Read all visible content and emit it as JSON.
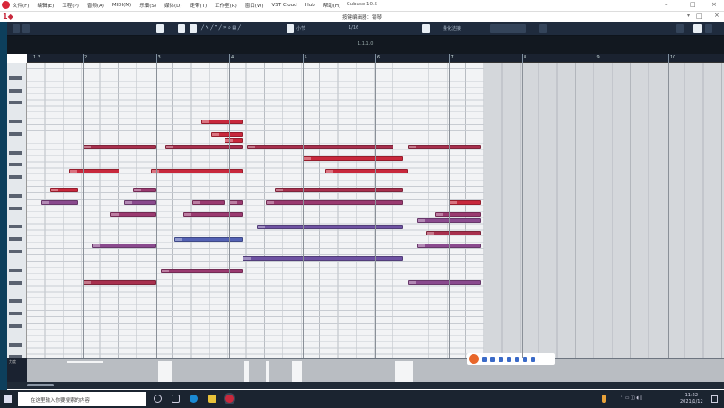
{
  "app": {
    "title": "Cubase 10.5",
    "menu": [
      "文件(F)",
      "编辑(E)",
      "工程(P)",
      "音频(A)",
      "MIDI(M)",
      "乐谱(S)",
      "媒体(D)",
      "走带(T)",
      "工作室(R)",
      "窗口(W)",
      "VST Cloud",
      "Hub",
      "帮助(H)"
    ]
  },
  "editor": {
    "window_title": "按键编辑器：钢琴",
    "position": "1.1.1.0",
    "snap": "小节",
    "quantize": "1/16",
    "length": "量化连接"
  },
  "ruler": {
    "bars": [
      "1.3",
      "2",
      "3",
      "4",
      "5",
      "6",
      "7",
      "8",
      "9",
      "10"
    ]
  },
  "colors": {
    "red": "#c8283c",
    "crimson": "#a8304e",
    "magenta": "#9a3a70",
    "purple": "#8a4a8e",
    "violet": "#6e52a2",
    "blue": "#5462b4"
  },
  "notes": [
    {
      "start": 10.5,
      "length": 2.25,
      "pitch": 75,
      "color": "red"
    },
    {
      "start": 11,
      "length": 1.75,
      "pitch": 73,
      "color": "red"
    },
    {
      "start": 11.75,
      "length": 1,
      "pitch": 72,
      "color": "red"
    },
    {
      "start": 4,
      "length": 4,
      "pitch": 71,
      "color": "crimson"
    },
    {
      "start": 8.5,
      "length": 4.25,
      "pitch": 71,
      "color": "crimson"
    },
    {
      "start": 13,
      "length": 8,
      "pitch": 71,
      "color": "crimson"
    },
    {
      "start": 21.75,
      "length": 4,
      "pitch": 71,
      "color": "crimson"
    },
    {
      "start": 16,
      "length": 5.5,
      "pitch": 69,
      "color": "red"
    },
    {
      "start": 3.25,
      "length": 2.75,
      "pitch": 67,
      "color": "red"
    },
    {
      "start": 7.75,
      "length": 5,
      "pitch": 67,
      "color": "red"
    },
    {
      "start": 17.25,
      "length": 4.5,
      "pitch": 67,
      "color": "red"
    },
    {
      "start": 2.25,
      "length": 1.5,
      "pitch": 64,
      "color": "red"
    },
    {
      "start": 6.75,
      "length": 1.25,
      "pitch": 64,
      "color": "magenta"
    },
    {
      "start": 14.5,
      "length": 7,
      "pitch": 64,
      "color": "crimson"
    },
    {
      "start": 1.75,
      "length": 2,
      "pitch": 62,
      "color": "purple"
    },
    {
      "start": 6.25,
      "length": 1.75,
      "pitch": 62,
      "color": "purple"
    },
    {
      "start": 10,
      "length": 1.75,
      "pitch": 62,
      "color": "magenta"
    },
    {
      "start": 12,
      "length": 0.75,
      "pitch": 62,
      "color": "magenta"
    },
    {
      "start": 14,
      "length": 7.5,
      "pitch": 62,
      "color": "magenta"
    },
    {
      "start": 24,
      "length": 1.75,
      "pitch": 62,
      "color": "red"
    },
    {
      "start": 5.5,
      "length": 2.5,
      "pitch": 60,
      "color": "magenta"
    },
    {
      "start": 9.5,
      "length": 3.25,
      "pitch": 60,
      "color": "magenta"
    },
    {
      "start": 23.25,
      "length": 2.5,
      "pitch": 60,
      "color": "magenta"
    },
    {
      "start": 13.5,
      "length": 8,
      "pitch": 58,
      "color": "violet"
    },
    {
      "start": 22.25,
      "length": 3.5,
      "pitch": 59,
      "color": "purple"
    },
    {
      "start": 22.75,
      "length": 3,
      "pitch": 57,
      "color": "crimson"
    },
    {
      "start": 9,
      "length": 3.75,
      "pitch": 56,
      "color": "blue"
    },
    {
      "start": 4.5,
      "length": 3.5,
      "pitch": 55,
      "color": "purple"
    },
    {
      "start": 22.25,
      "length": 3.5,
      "pitch": 55,
      "color": "purple"
    },
    {
      "start": 12.75,
      "length": 8.75,
      "pitch": 53,
      "color": "violet"
    },
    {
      "start": 8.25,
      "length": 4.5,
      "pitch": 51,
      "color": "magenta"
    },
    {
      "start": 4,
      "length": 4,
      "pitch": 49,
      "color": "crimson"
    },
    {
      "start": 21.75,
      "length": 4,
      "pitch": 49,
      "color": "purple"
    }
  ],
  "controller": {
    "label": "力度"
  },
  "taskbar": {
    "search_placeholder": "在这里输入你要搜索的内容",
    "time": "11:22",
    "date": "2021/1/12"
  }
}
